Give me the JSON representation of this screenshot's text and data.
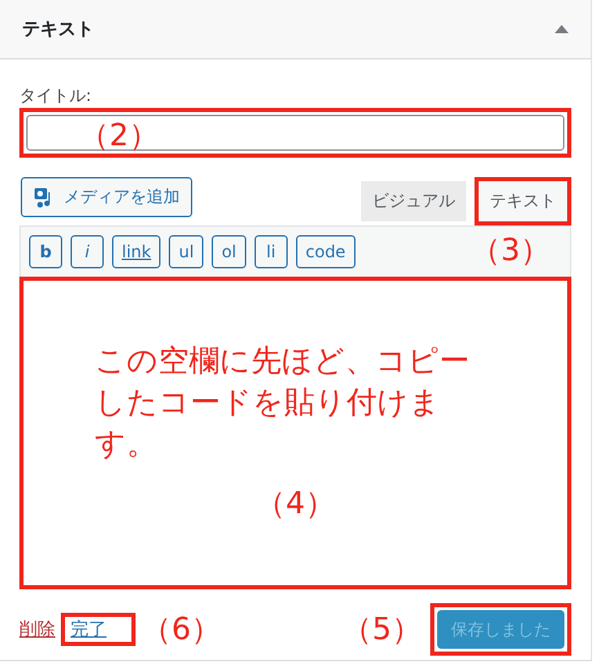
{
  "widget": {
    "title": "テキスト",
    "expanded": true
  },
  "title_field": {
    "label": "タイトル:",
    "annotation": "（2）"
  },
  "media_button": {
    "label": "メディアを追加"
  },
  "tabs": [
    {
      "label": "ビジュアル",
      "selected": false,
      "highlighted": false
    },
    {
      "label": "テキスト",
      "selected": true,
      "highlighted": true
    }
  ],
  "tabs_annotation": "（3）",
  "quicktags": [
    "b",
    "i",
    "link",
    "ul",
    "ol",
    "li",
    "code"
  ],
  "editor": {
    "note": "この空欄に先ほど、コピーしたコードを貼り付けます。",
    "annotation": "（4）"
  },
  "footer": {
    "delete_link": "削除",
    "done_link": "完了",
    "done_annotation": "（6）",
    "save_annotation": "（5）",
    "save_button": {
      "label": "保存しました",
      "disabled": true
    }
  }
}
